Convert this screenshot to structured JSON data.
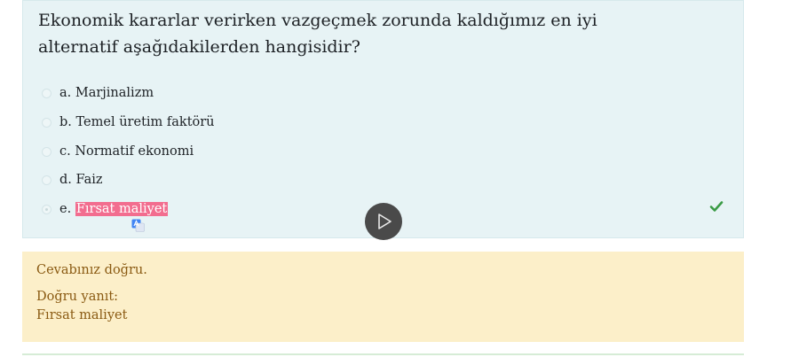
{
  "question": {
    "text": "Ekonomik kararlar verirken vazgeçmek zorunda kaldığımız en iyi alternatif aşağıdakilerden hangisidir?",
    "options": [
      {
        "letter": "a.",
        "text": "Marjinalizm",
        "selected": false
      },
      {
        "letter": "b.",
        "text": "Temel üretim faktörü",
        "selected": false
      },
      {
        "letter": "c.",
        "text": "Normatif ekonomi",
        "selected": false
      },
      {
        "letter": "d.",
        "text": "Faiz",
        "selected": false
      },
      {
        "letter": "e.",
        "text": "Fırsat maliyet",
        "selected": true
      }
    ]
  },
  "feedback": {
    "result": "Cevabınız doğru.",
    "correct_label": "Doğru yanıt:",
    "correct_answer": "Fırsat maliyet"
  },
  "icons": {
    "correct_mark": "check-icon",
    "video": "play-icon",
    "translate": "translate-icon"
  },
  "colors": {
    "question_bg": "#e7f3f5",
    "feedback_bg": "#fcefc9",
    "highlight": "#f26d8f",
    "check": "#3a9b45"
  }
}
